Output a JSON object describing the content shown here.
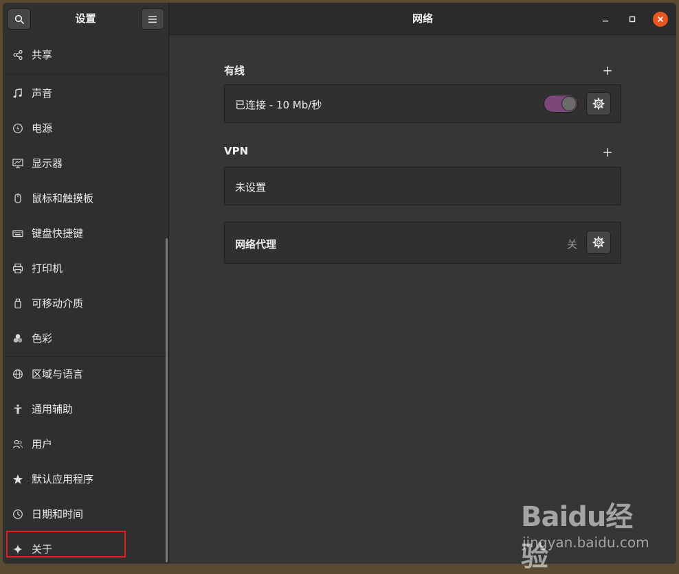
{
  "sidebar": {
    "title": "设置",
    "items": [
      {
        "label": "共享",
        "icon": "share-icon"
      },
      {
        "label": "声音",
        "icon": "music-note-icon"
      },
      {
        "label": "电源",
        "icon": "power-icon"
      },
      {
        "label": "显示器",
        "icon": "display-icon"
      },
      {
        "label": "鼠标和触摸板",
        "icon": "mouse-icon"
      },
      {
        "label": "键盘快捷键",
        "icon": "keyboard-icon"
      },
      {
        "label": "打印机",
        "icon": "printer-icon"
      },
      {
        "label": "可移动介质",
        "icon": "usb-drive-icon"
      },
      {
        "label": "色彩",
        "icon": "color-icon"
      },
      {
        "label": "区域与语言",
        "icon": "globe-icon"
      },
      {
        "label": "通用辅助",
        "icon": "accessibility-icon"
      },
      {
        "label": "用户",
        "icon": "users-icon"
      },
      {
        "label": "默认应用程序",
        "icon": "star-icon"
      },
      {
        "label": "日期和时间",
        "icon": "clock-icon"
      },
      {
        "label": "关于",
        "icon": "sparkle-icon"
      }
    ]
  },
  "main": {
    "title": "网络",
    "wired": {
      "title": "有线",
      "status": "已连接 - 10 Mb/秒",
      "enabled": true
    },
    "vpn": {
      "title": "VPN",
      "status": "未设置"
    },
    "proxy": {
      "title": "网络代理",
      "status": "关"
    }
  },
  "colors": {
    "accent_toggle": "#7a4778",
    "close_button": "#e9541f",
    "highlight_box": "#e41e1e"
  },
  "watermark": {
    "brand": "Baidu经验",
    "url": "jingyan.baidu.com"
  }
}
